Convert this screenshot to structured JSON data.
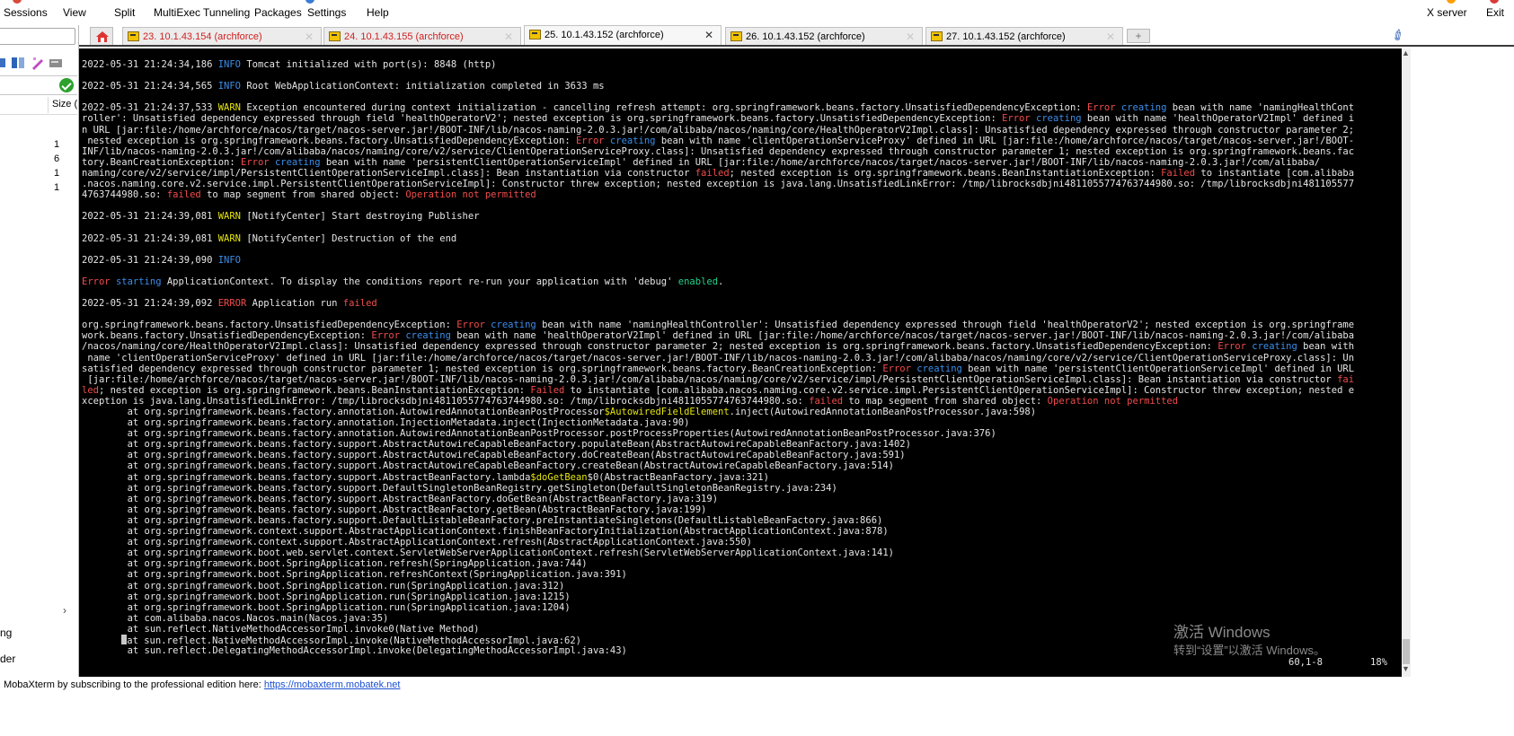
{
  "menu": {
    "items": [
      "Sessions",
      "View",
      "Split",
      "MultiExec",
      "Tunneling",
      "Packages",
      "Settings",
      "Help"
    ],
    "right_items": [
      "X server",
      "Exit"
    ]
  },
  "sidebar": {
    "column_header": "Size (",
    "size_values": [
      "1",
      "6",
      "1",
      "1"
    ],
    "bottom_items": [
      "ng",
      "der"
    ]
  },
  "tabs": [
    {
      "label": "23. 10.1.43.154 (archforce)",
      "color": "red",
      "active": false
    },
    {
      "label": "24. 10.1.43.155 (archforce)",
      "color": "red",
      "active": false
    },
    {
      "label": "25. 10.1.43.152 (archforce)",
      "color": "dark",
      "active": true
    },
    {
      "label": "26. 10.1.43.152 (archforce)",
      "color": "dark",
      "active": false
    },
    {
      "label": "27. 10.1.43.152 (archforce)",
      "color": "dark",
      "active": false
    }
  ],
  "terminal": {
    "lines": [
      [
        [
          "2022-05-31 21:24:34,186 ",
          ""
        ],
        [
          "INFO",
          "info"
        ],
        [
          " Tomcat initialized with port(s): 8848 (http)",
          ""
        ]
      ],
      [],
      [
        [
          "2022-05-31 21:24:34,565 ",
          ""
        ],
        [
          "INFO",
          "info"
        ],
        [
          " Root WebApplicationContext: initialization completed in 3633 ms",
          ""
        ]
      ],
      [],
      [
        [
          "2022-05-31 21:24:37,533 ",
          ""
        ],
        [
          "WARN",
          "warn"
        ],
        [
          " Exception encountered during context initialization - cancelling refresh attempt: org.springframework.beans.factory.UnsatisfiedDependencyException: ",
          ""
        ],
        [
          "Error",
          "error"
        ],
        [
          " ",
          ""
        ],
        [
          "creating",
          "blue"
        ],
        [
          " bean with name 'namingHealthCont",
          ""
        ]
      ],
      [
        [
          "roller': Unsatisfied dependency expressed through field 'healthOperatorV2'; nested exception is org.springframework.beans.factory.UnsatisfiedDependencyException: ",
          ""
        ],
        [
          "Error",
          "error"
        ],
        [
          " ",
          ""
        ],
        [
          "creating",
          "blue"
        ],
        [
          " bean with name 'healthOperatorV2Impl' defined i",
          ""
        ]
      ],
      [
        [
          "n URL [jar:file:/home/archforce/nacos/target/nacos-server.jar!/BOOT-INF/lib/nacos-naming-2.0.3.jar!/com/alibaba/nacos/naming/core/HealthOperatorV2Impl.class]: Unsatisfied dependency expressed through constructor parameter 2;",
          ""
        ]
      ],
      [
        [
          " nested exception is org.springframework.beans.factory.UnsatisfiedDependencyException: ",
          ""
        ],
        [
          "Error",
          "error"
        ],
        [
          " ",
          ""
        ],
        [
          "creating",
          "blue"
        ],
        [
          " bean with name 'clientOperationServiceProxy' defined in URL [jar:file:/home/archforce/nacos/target/nacos-server.jar!/BOOT-",
          ""
        ]
      ],
      [
        [
          "INF/lib/nacos-naming-2.0.3.jar!/com/alibaba/nacos/naming/core/v2/service/ClientOperationServiceProxy.class]: Unsatisfied dependency expressed through constructor parameter 1; nested exception is org.springframework.beans.fac",
          ""
        ]
      ],
      [
        [
          "tory.BeanCreationException: ",
          ""
        ],
        [
          "Error",
          "error"
        ],
        [
          " ",
          ""
        ],
        [
          "creating",
          "blue"
        ],
        [
          " bean with name 'persistentClientOperationServiceImpl' defined in URL [jar:file:/home/archforce/nacos/target/nacos-server.jar!/BOOT-INF/lib/nacos-naming-2.0.3.jar!/com/alibaba/",
          ""
        ]
      ],
      [
        [
          "naming/core/v2/service/impl/PersistentClientOperationServiceImpl.class]: Bean instantiation via constructor ",
          ""
        ],
        [
          "failed",
          "error"
        ],
        [
          "; nested exception is org.springframework.beans.BeanInstantiationException: ",
          ""
        ],
        [
          "Failed",
          "error"
        ],
        [
          " to instantiate [com.alibaba",
          ""
        ]
      ],
      [
        [
          ".nacos.naming.core.v2.service.impl.PersistentClientOperationServiceImpl]: Constructor threw exception; nested exception is java.lang.UnsatisfiedLinkError: /tmp/librocksdbjni4811055774763744980.so: /tmp/librocksdbjni481105577",
          ""
        ]
      ],
      [
        [
          "4763744980.so: ",
          ""
        ],
        [
          "failed",
          "error"
        ],
        [
          " to map segment from shared object: ",
          ""
        ],
        [
          "Operation not permitted",
          "error"
        ]
      ],
      [],
      [
        [
          "2022-05-31 21:24:39,081 ",
          ""
        ],
        [
          "WARN",
          "warn"
        ],
        [
          " [NotifyCenter] Start destroying Publisher",
          ""
        ]
      ],
      [],
      [
        [
          "2022-05-31 21:24:39,081 ",
          ""
        ],
        [
          "WARN",
          "warn"
        ],
        [
          " [NotifyCenter] Destruction of the end",
          ""
        ]
      ],
      [],
      [
        [
          "2022-05-31 21:24:39,090 ",
          ""
        ],
        [
          "INFO",
          "info"
        ]
      ],
      [],
      [
        [
          "Error",
          "error"
        ],
        [
          " ",
          ""
        ],
        [
          "starting",
          "blue"
        ],
        [
          " ApplicationContext. To display the conditions report re-run your application with 'debug' ",
          ""
        ],
        [
          "enabled",
          "green"
        ],
        [
          ".",
          ""
        ]
      ],
      [],
      [
        [
          "2022-05-31 21:24:39,092 ",
          ""
        ],
        [
          "ERROR",
          "error"
        ],
        [
          " Application run ",
          ""
        ],
        [
          "failed",
          "error"
        ]
      ],
      [],
      [
        [
          "org.springframework.beans.factory.UnsatisfiedDependencyException: ",
          ""
        ],
        [
          "Error",
          "error"
        ],
        [
          " ",
          ""
        ],
        [
          "creating",
          "blue"
        ],
        [
          " bean with name 'namingHealthController': Unsatisfied dependency expressed through field 'healthOperatorV2'; nested exception is org.springframe",
          ""
        ]
      ],
      [
        [
          "work.beans.factory.UnsatisfiedDependencyException: ",
          ""
        ],
        [
          "Error",
          "error"
        ],
        [
          " ",
          ""
        ],
        [
          "creating",
          "blue"
        ],
        [
          " bean with name 'healthOperatorV2Impl' defined in URL [jar:file:/home/archforce/nacos/target/nacos-server.jar!/BOOT-INF/lib/nacos-naming-2.0.3.jar!/com/alibaba",
          ""
        ]
      ],
      [
        [
          "/nacos/naming/core/HealthOperatorV2Impl.class]: Unsatisfied dependency expressed through constructor parameter 2; nested exception is org.springframework.beans.factory.UnsatisfiedDependencyException: ",
          ""
        ],
        [
          "Error",
          "error"
        ],
        [
          " ",
          ""
        ],
        [
          "creating",
          "blue"
        ],
        [
          " bean with",
          ""
        ]
      ],
      [
        [
          " name 'clientOperationServiceProxy' defined in URL [jar:file:/home/archforce/nacos/target/nacos-server.jar!/BOOT-INF/lib/nacos-naming-2.0.3.jar!/com/alibaba/nacos/naming/core/v2/service/ClientOperationServiceProxy.class]: Un",
          ""
        ]
      ],
      [
        [
          "satisfied dependency expressed through constructor parameter 1; nested exception is org.springframework.beans.factory.BeanCreationException: ",
          ""
        ],
        [
          "Error",
          "error"
        ],
        [
          " ",
          ""
        ],
        [
          "creating",
          "blue"
        ],
        [
          " bean with name 'persistentClientOperationServiceImpl' defined in URL",
          ""
        ]
      ],
      [
        [
          " [jar:file:/home/archforce/nacos/target/nacos-server.jar!/BOOT-INF/lib/nacos-naming-2.0.3.jar!/com/alibaba/nacos/naming/core/v2/service/impl/PersistentClientOperationServiceImpl.class]: Bean instantiation via constructor ",
          ""
        ],
        [
          "fai",
          "error"
        ]
      ],
      [
        [
          "led",
          "error"
        ],
        [
          "; nested exception is org.springframework.beans.BeanInstantiationException: ",
          ""
        ],
        [
          "Failed",
          "error"
        ],
        [
          " to instantiate [com.alibaba.nacos.naming.core.v2.service.impl.PersistentClientOperationServiceImpl]: Constructor threw exception; nested e",
          ""
        ]
      ],
      [
        [
          "xception is java.lang.UnsatisfiedLinkError: /tmp/librocksdbjni4811055774763744980.so: /tmp/librocksdbjni4811055774763744980.so: ",
          ""
        ],
        [
          "failed",
          "error"
        ],
        [
          " to map segment from shared object: ",
          ""
        ],
        [
          "Operation not permitted",
          "error"
        ]
      ],
      [
        [
          "        at org.springframework.beans.factory.annotation.AutowiredAnnotationBeanPostProcessor",
          ""
        ],
        [
          "$AutowiredFieldElement",
          "yellow"
        ],
        [
          ".inject(AutowiredAnnotationBeanPostProcessor.java:598)",
          ""
        ]
      ],
      [
        [
          "        at org.springframework.beans.factory.annotation.InjectionMetadata.inject(InjectionMetadata.java:90)",
          ""
        ]
      ],
      [
        [
          "        at org.springframework.beans.factory.annotation.AutowiredAnnotationBeanPostProcessor.postProcessProperties(AutowiredAnnotationBeanPostProcessor.java:376)",
          ""
        ]
      ],
      [
        [
          "        at org.springframework.beans.factory.support.AbstractAutowireCapableBeanFactory.populateBean(AbstractAutowireCapableBeanFactory.java:1402)",
          ""
        ]
      ],
      [
        [
          "        at org.springframework.beans.factory.support.AbstractAutowireCapableBeanFactory.doCreateBean(AbstractAutowireCapableBeanFactory.java:591)",
          ""
        ]
      ],
      [
        [
          "        at org.springframework.beans.factory.support.AbstractAutowireCapableBeanFactory.createBean(AbstractAutowireCapableBeanFactory.java:514)",
          ""
        ]
      ],
      [
        [
          "        at org.springframework.beans.factory.support.AbstractBeanFactory.lambda",
          ""
        ],
        [
          "$doGetBean",
          "yellow"
        ],
        [
          "$0(AbstractBeanFactory.java:321)",
          ""
        ]
      ],
      [
        [
          "        at org.springframework.beans.factory.support.DefaultSingletonBeanRegistry.getSingleton(DefaultSingletonBeanRegistry.java:234)",
          ""
        ]
      ],
      [
        [
          "        at org.springframework.beans.factory.support.AbstractBeanFactory.doGetBean(AbstractBeanFactory.java:319)",
          ""
        ]
      ],
      [
        [
          "        at org.springframework.beans.factory.support.AbstractBeanFactory.getBean(AbstractBeanFactory.java:199)",
          ""
        ]
      ],
      [
        [
          "        at org.springframework.beans.factory.support.DefaultListableBeanFactory.preInstantiateSingletons(DefaultListableBeanFactory.java:866)",
          ""
        ]
      ],
      [
        [
          "        at org.springframework.context.support.AbstractApplicationContext.finishBeanFactoryInitialization(AbstractApplicationContext.java:878)",
          ""
        ]
      ],
      [
        [
          "        at org.springframework.context.support.AbstractApplicationContext.refresh(AbstractApplicationContext.java:550)",
          ""
        ]
      ],
      [
        [
          "        at org.springframework.boot.web.servlet.context.ServletWebServerApplicationContext.refresh(ServletWebServerApplicationContext.java:141)",
          ""
        ]
      ],
      [
        [
          "        at org.springframework.boot.SpringApplication.refresh(SpringApplication.java:744)",
          ""
        ]
      ],
      [
        [
          "        at org.springframework.boot.SpringApplication.refreshContext(SpringApplication.java:391)",
          ""
        ]
      ],
      [
        [
          "        at org.springframework.boot.SpringApplication.run(SpringApplication.java:312)",
          ""
        ]
      ],
      [
        [
          "        at org.springframework.boot.SpringApplication.run(SpringApplication.java:1215)",
          ""
        ]
      ],
      [
        [
          "        at org.springframework.boot.SpringApplication.run(SpringApplication.java:1204)",
          ""
        ]
      ],
      [
        [
          "        at com.alibaba.nacos.Nacos.main(Nacos.java:35)",
          ""
        ]
      ],
      [
        [
          "        at sun.reflect.NativeMethodAccessorImpl.invoke0(Native Method)",
          ""
        ]
      ],
      [
        [
          "       ",
          ""
        ],
        [
          "CURSOR",
          "cursor"
        ],
        [
          "at sun.reflect.NativeMethodAccessorImpl.invoke(NativeMethodAccessorImpl.java:62)",
          ""
        ]
      ],
      [
        [
          "        at sun.reflect.DelegatingMethodAccessorImpl.invoke(DelegatingMethodAccessorImpl.java:43)",
          ""
        ]
      ]
    ],
    "cursor_position": "60,1-8",
    "scroll_percent": "18%"
  },
  "watermark": {
    "title": "激活 Windows",
    "subtitle": "转到“设置”以激活 Windows。"
  },
  "promo": {
    "text": "MobaXterm by subscribing to the professional edition here: ",
    "link": "https://mobaxterm.mobatek.net"
  },
  "colors": {
    "terminal_bg": "#000000",
    "terminal_fg": "#e6e6e6",
    "info": "#3b8eea",
    "warn": "#e5e510",
    "error": "#f14c4c",
    "green": "#23d18b",
    "tab_red": "#d02020"
  }
}
